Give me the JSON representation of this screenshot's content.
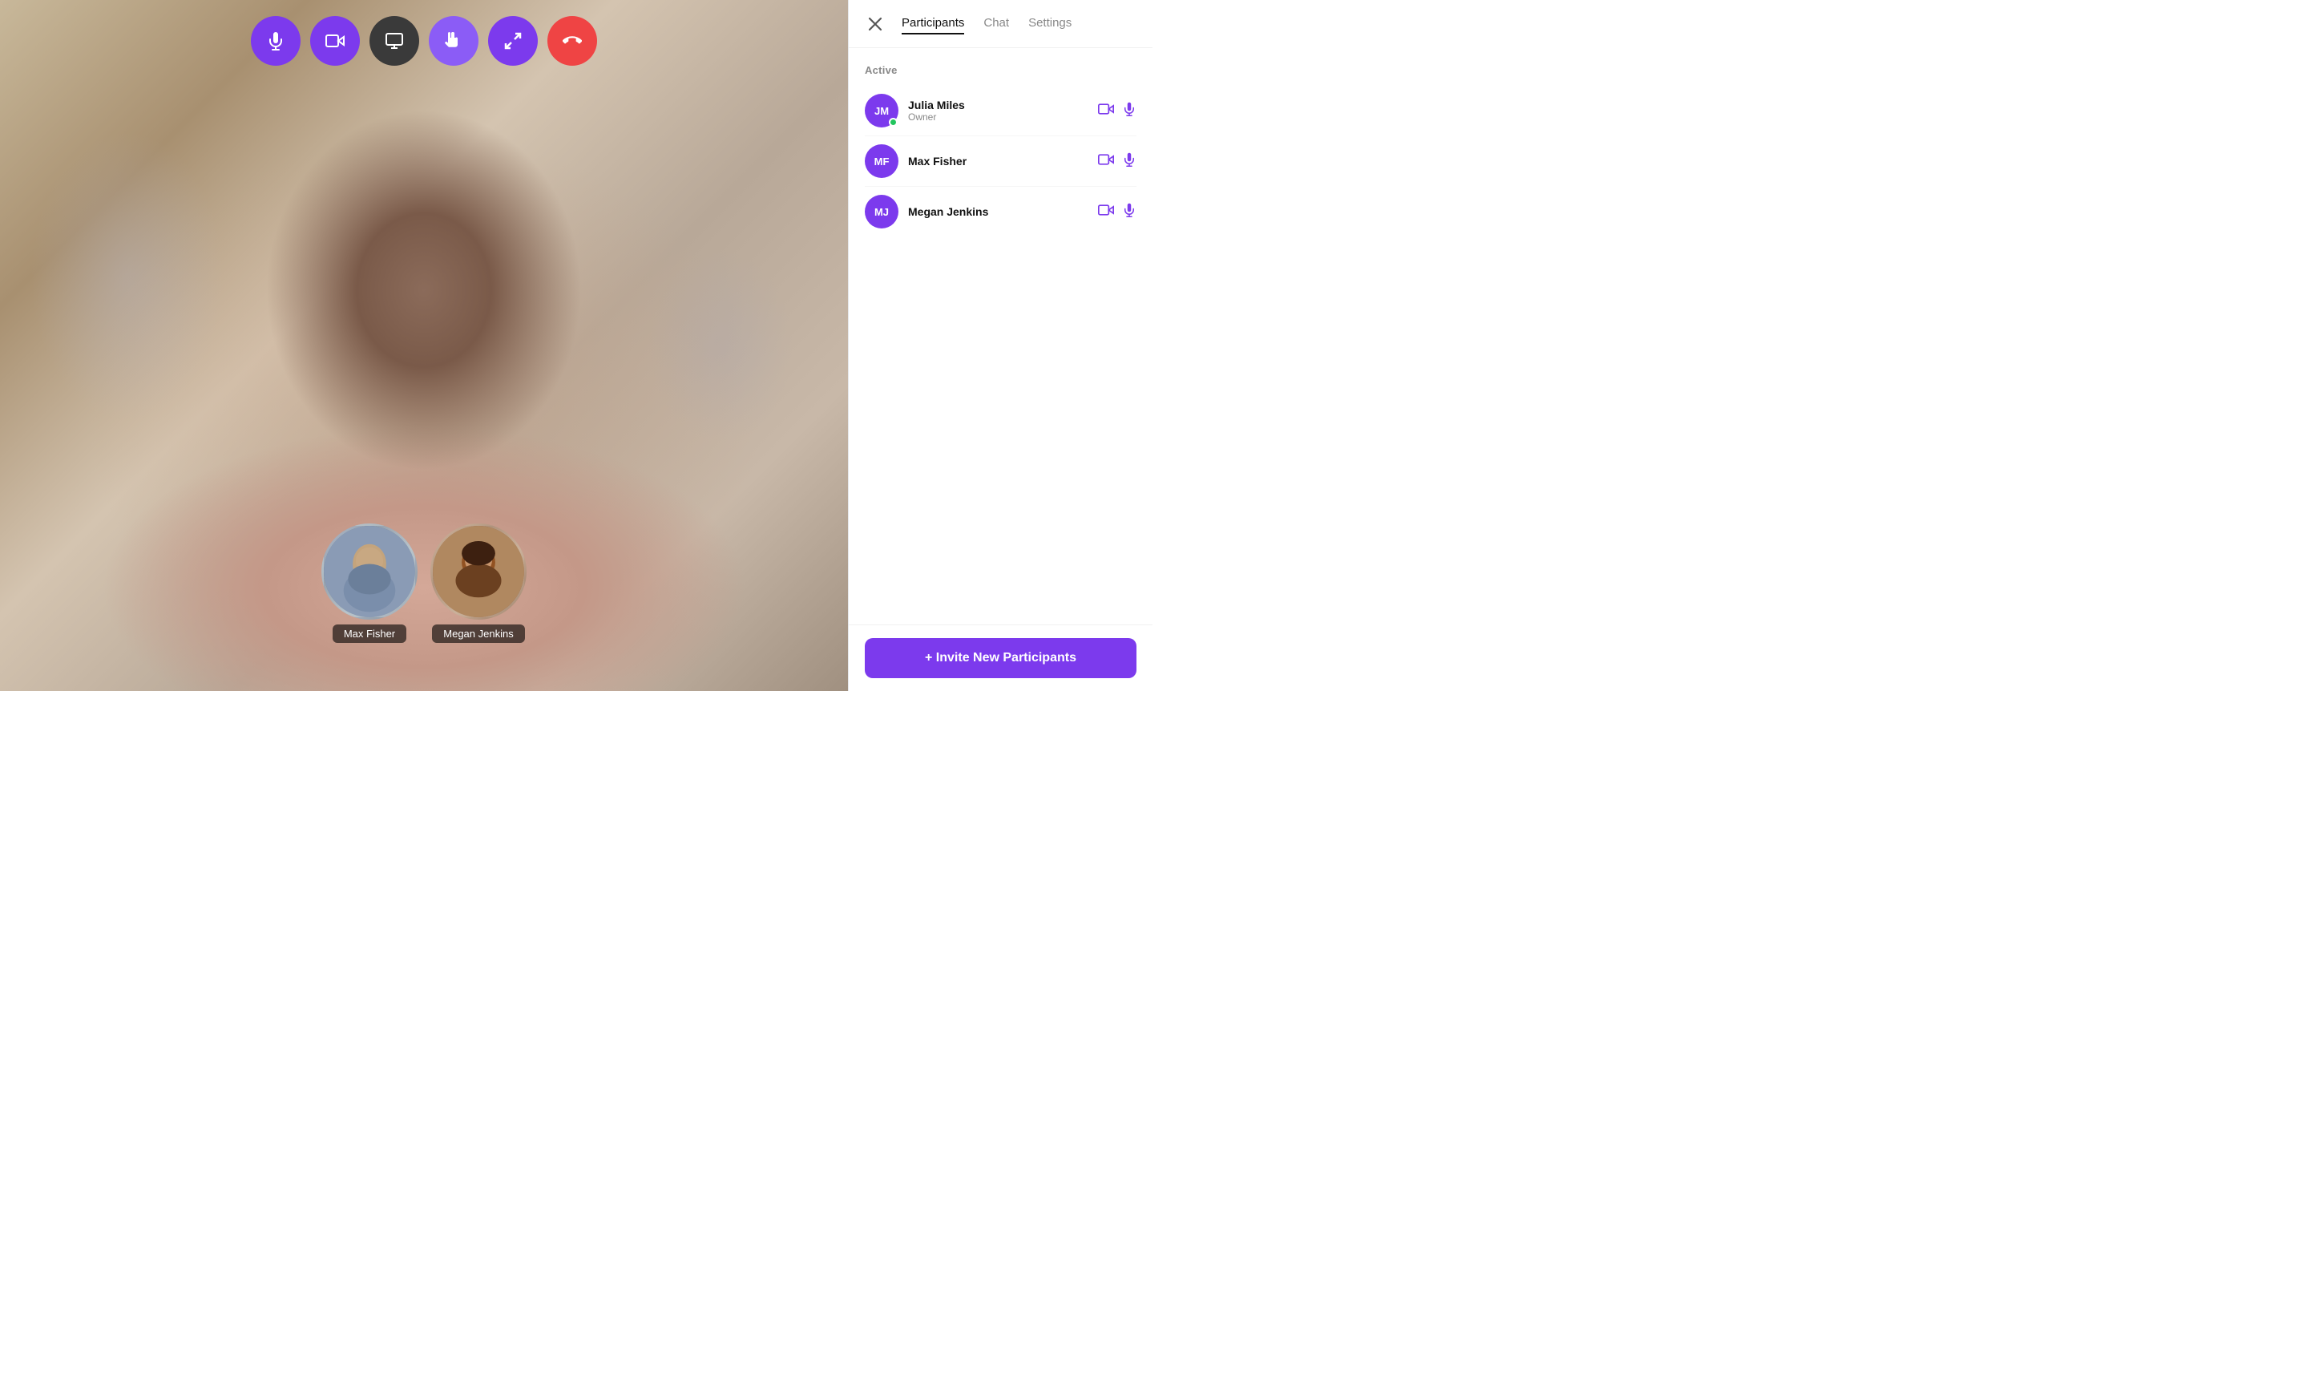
{
  "tabs": {
    "participants_label": "Participants",
    "chat_label": "Chat",
    "settings_label": "Settings",
    "active": "Participants"
  },
  "section": {
    "active_label": "Active"
  },
  "participants": [
    {
      "id": "jm",
      "initials": "JM",
      "name": "Julia Miles",
      "role": "Owner",
      "online": true
    },
    {
      "id": "mf",
      "initials": "MF",
      "name": "Max Fisher",
      "role": "",
      "online": false
    },
    {
      "id": "mj",
      "initials": "MJ",
      "name": "Megan Jenkins",
      "role": "",
      "online": false
    }
  ],
  "thumbnails": [
    {
      "id": "max",
      "label": "Max Fisher"
    },
    {
      "id": "megan",
      "label": "Megan Jenkins"
    }
  ],
  "invite_button_label": "+ Invite New Participants",
  "controls": [
    {
      "id": "mic",
      "type": "purple",
      "icon": "mic"
    },
    {
      "id": "video",
      "type": "purple",
      "icon": "video"
    },
    {
      "id": "screen",
      "type": "dark",
      "icon": "screen"
    },
    {
      "id": "effects",
      "type": "purple",
      "icon": "effects"
    },
    {
      "id": "expand",
      "type": "purple",
      "icon": "expand"
    },
    {
      "id": "end",
      "type": "red",
      "icon": "phone"
    }
  ]
}
